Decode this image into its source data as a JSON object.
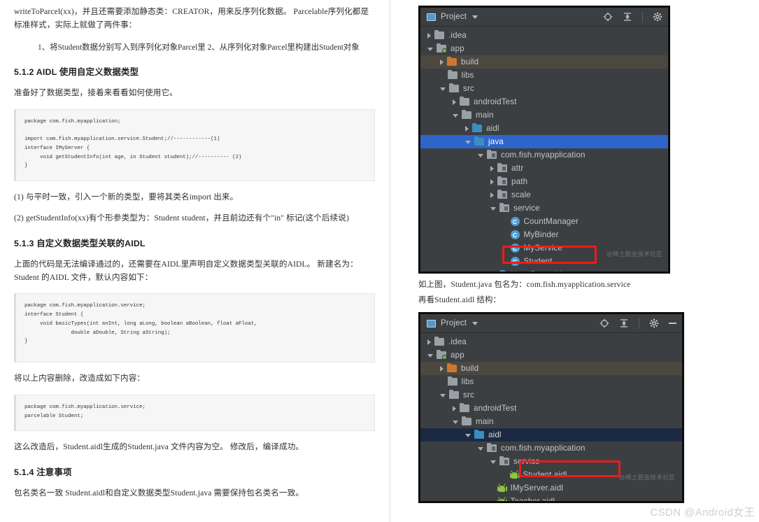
{
  "document": {
    "intro_paragraph": "writeToParcel(xx)，并且还需要添加静态类：CREATOR，用来反序列化数据。 Parcelable序列化都是标准样式，实际上就做了两件事：",
    "indent_paragraph": "1、将Student数据分别写入到序列化对象Parcel里 2、从序列化对象Parcel里构建出Student对象",
    "heading_512": "5.1.2 AIDL 使用自定义数据类型",
    "para_after_512": "准备好了数据类型，接着来看看如何使用它。",
    "code_block_1": "package com.fish.myapplication;\n\nimport com.fish.myapplication.service.Student;//------------(1)\ninterface IMyServer {\n     void getStudentInfo(int age, in Student student);//---------- (2)\n}",
    "note_1": "(1) 与平时一致，引入一个新的类型，要将其类名import 出来。",
    "note_2": "(2) getStudentInfo(xx)有个形参类型为：Student student，并且前边还有个\"in\" 标记(这个后续说)",
    "heading_513": "5.1.3 自定义数据类型关联的AIDL",
    "para_after_513": "上面的代码是无法编译通过的，还需要在AIDL里声明自定义数据类型关联的AIDL。 新建名为：Student 的AIDL 文件，默认内容如下：",
    "code_block_2": "package com.fish.myapplication.service;\ninterface Student {\n     void basicTypes(int anInt, long aLong, boolean aBoolean, float aFloat,\n               double aDouble, String aString);\n}",
    "para_replace": "将以上内容删除，改造成如下内容：",
    "code_block_3": "package com.fish.myapplication.service;\nparcelable Student;",
    "para_after_code3": "这么改造后，Student.aidl生成的Student.java 文件内容为空。 修改后，编译成功。",
    "heading_514": "5.1.4 注意事项",
    "para_514": "包名类名一致 Student.aidl和自定义数据类型Student.java 需要保持包名类名一致。"
  },
  "ide_panel_1": {
    "title": "Project",
    "watermark": "@稀土掘金技术社区",
    "icons": {
      "project": "project-window-icon",
      "locate": "locate-target-icon",
      "collapse": "collapse-all-icon",
      "settings": "gear-icon",
      "dropdown": "chevron-down-icon"
    },
    "tree": [
      {
        "label": ".idea",
        "indent": 1,
        "arrow": "closed",
        "icon": "folder-grey",
        "state": "normal"
      },
      {
        "label": "app",
        "indent": 1,
        "arrow": "open",
        "icon": "folder-module",
        "state": "normal"
      },
      {
        "label": "build",
        "indent": 2,
        "arrow": "closed",
        "icon": "folder-orange",
        "state": "hover"
      },
      {
        "label": "libs",
        "indent": 2,
        "arrow": "none",
        "icon": "folder-grey",
        "state": "normal"
      },
      {
        "label": "src",
        "indent": 2,
        "arrow": "open",
        "icon": "folder-grey",
        "state": "normal"
      },
      {
        "label": "androidTest",
        "indent": 3,
        "arrow": "closed",
        "icon": "folder-grey",
        "state": "normal"
      },
      {
        "label": "main",
        "indent": 3,
        "arrow": "open",
        "icon": "folder-grey",
        "state": "normal"
      },
      {
        "label": "aidl",
        "indent": 4,
        "arrow": "closed",
        "icon": "folder-teal",
        "state": "normal"
      },
      {
        "label": "java",
        "indent": 4,
        "arrow": "open",
        "icon": "folder-teal",
        "state": "selected-active"
      },
      {
        "label": "com.fish.myapplication",
        "indent": 5,
        "arrow": "open",
        "icon": "folder-package",
        "state": "normal"
      },
      {
        "label": "attr",
        "indent": 6,
        "arrow": "closed",
        "icon": "folder-package",
        "state": "normal"
      },
      {
        "label": "path",
        "indent": 6,
        "arrow": "closed",
        "icon": "folder-package",
        "state": "normal"
      },
      {
        "label": "scale",
        "indent": 6,
        "arrow": "closed",
        "icon": "folder-package",
        "state": "normal"
      },
      {
        "label": "service",
        "indent": 6,
        "arrow": "open",
        "icon": "folder-package",
        "state": "normal"
      },
      {
        "label": "CountManager",
        "indent": 7,
        "arrow": "none",
        "icon": "java-class",
        "state": "normal"
      },
      {
        "label": "MyBinder",
        "indent": 7,
        "arrow": "none",
        "icon": "java-class",
        "state": "normal"
      },
      {
        "label": "MyService",
        "indent": 7,
        "arrow": "none",
        "icon": "java-class",
        "state": "normal"
      },
      {
        "label": "Student",
        "indent": 7,
        "arrow": "none",
        "icon": "java-class",
        "state": "normal"
      },
      {
        "label": "HeadDrawable",
        "indent": 6,
        "arrow": "none",
        "icon": "java-class",
        "state": "normal"
      }
    ],
    "annotation": {
      "name": "red-highlight-student",
      "color": "#ef1b1b"
    }
  },
  "mid_text": {
    "line1": "如上图，Student.java 包名为：com.fish.myapplication.service",
    "line2": "再看Student.aidl 结构："
  },
  "ide_panel_2": {
    "title": "Project",
    "watermark": "@稀土掘金技术社区",
    "icons": {
      "project": "project-window-icon",
      "locate": "locate-target-icon",
      "collapse": "collapse-all-icon",
      "settings": "gear-icon",
      "minimize": "minimize-icon",
      "dropdown": "chevron-down-icon"
    },
    "tree": [
      {
        "label": ".idea",
        "indent": 1,
        "arrow": "closed",
        "icon": "folder-grey",
        "state": "normal"
      },
      {
        "label": "app",
        "indent": 1,
        "arrow": "open",
        "icon": "folder-module",
        "state": "normal"
      },
      {
        "label": "build",
        "indent": 2,
        "arrow": "closed",
        "icon": "folder-orange",
        "state": "hover"
      },
      {
        "label": "libs",
        "indent": 2,
        "arrow": "none",
        "icon": "folder-grey",
        "state": "normal"
      },
      {
        "label": "src",
        "indent": 2,
        "arrow": "open",
        "icon": "folder-grey",
        "state": "normal"
      },
      {
        "label": "androidTest",
        "indent": 3,
        "arrow": "closed",
        "icon": "folder-grey",
        "state": "normal"
      },
      {
        "label": "main",
        "indent": 3,
        "arrow": "open",
        "icon": "folder-grey",
        "state": "normal"
      },
      {
        "label": "aidl",
        "indent": 4,
        "arrow": "open",
        "icon": "folder-teal",
        "state": "selected-inactive"
      },
      {
        "label": "com.fish.myapplication",
        "indent": 5,
        "arrow": "open",
        "icon": "folder-package",
        "state": "normal"
      },
      {
        "label": "service",
        "indent": 6,
        "arrow": "open",
        "icon": "folder-package",
        "state": "normal"
      },
      {
        "label": "Student.aidl",
        "indent": 7,
        "arrow": "none",
        "icon": "android-aidl",
        "state": "normal"
      },
      {
        "label": "IMyServer.aidl",
        "indent": 6,
        "arrow": "none",
        "icon": "android-aidl",
        "state": "normal"
      },
      {
        "label": "Teacher.aidl",
        "indent": 6,
        "arrow": "none",
        "icon": "android-aidl",
        "state": "normal"
      }
    ],
    "annotation": {
      "name": "red-highlight-student-aidl",
      "color": "#ef1b1b"
    }
  },
  "csdn_watermark": "CSDN @Android女王"
}
